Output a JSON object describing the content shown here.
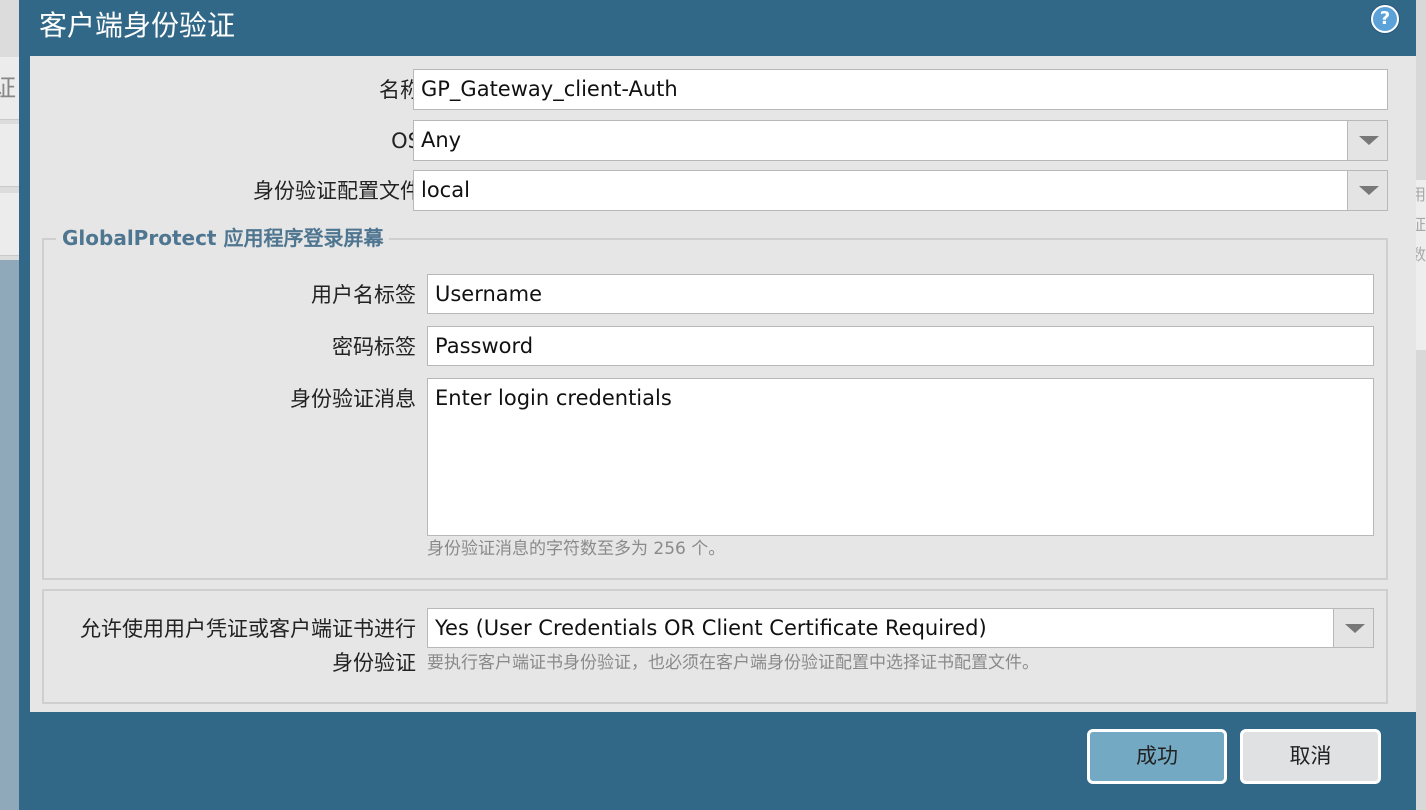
{
  "background": {
    "left_tab_char": "证",
    "right_strip_chars": [
      "用",
      "证",
      "数"
    ]
  },
  "dialog": {
    "title": "客户端身份验证",
    "help_icon": "help-icon"
  },
  "form": {
    "name": {
      "label": "名称",
      "value": "GP_Gateway_client-Auth"
    },
    "os": {
      "label": "OS",
      "value": "Any"
    },
    "auth_profile": {
      "label": "身份验证配置文件",
      "value": "local"
    }
  },
  "login_screen": {
    "legend": "GlobalProtect 应用程序登录屏幕",
    "username_label": {
      "label": "用户名标签",
      "value": "Username"
    },
    "password_label": {
      "label": "密码标签",
      "value": "Password"
    },
    "auth_message": {
      "label": "身份验证消息",
      "value": "Enter login credentials",
      "hint": "身份验证消息的字符数至多为 256 个。"
    }
  },
  "allow_auth": {
    "label_line1": "允许使用用户凭证或客户端证书进行",
    "label_line2": "身份验证",
    "value": "Yes (User Credentials OR Client Certificate Required)",
    "hint": "要执行客户端证书身份验证，也必须在客户端身份验证配置中选择证书配置文件。"
  },
  "buttons": {
    "ok": "成功",
    "cancel": "取消"
  },
  "colors": {
    "dialog_frame": "#316887",
    "legend_text": "#4f7690",
    "primary_button": "#74a9c4"
  }
}
